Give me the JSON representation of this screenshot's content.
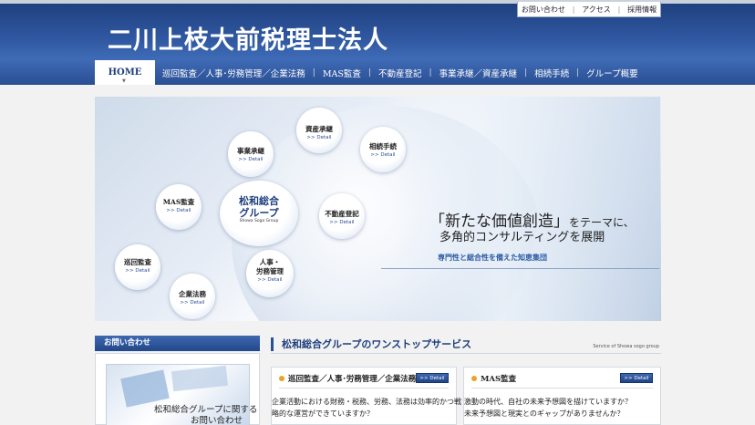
{
  "header": {
    "site_title": "二川上枝大前税理士法人",
    "util_nav": [
      "お問い合わせ",
      "アクセス",
      "採用情報"
    ]
  },
  "main_nav": {
    "home": "HOME",
    "items": [
      "巡回監査／人事･労務管理／企業法務",
      "MAS監査",
      "不動産登記",
      "事業承継／資産承継",
      "相続手続",
      "グループ概要"
    ]
  },
  "hero": {
    "center": {
      "title": "松和総合\nグループ",
      "sub": "Showa Sogo Group"
    },
    "bubbles": [
      {
        "title": "資産承継",
        "detail": ">> Detail"
      },
      {
        "title": "事業承継",
        "detail": ">> Detail"
      },
      {
        "title": "相続手続",
        "detail": ">> Detail"
      },
      {
        "title": "MAS監査",
        "detail": ">> Detail"
      },
      {
        "title": "不動産登記",
        "detail": ">> Detail"
      },
      {
        "title": "巡回監査",
        "detail": ">> Detail"
      },
      {
        "title": "人事・\n労務管理",
        "detail": ">> Detail"
      },
      {
        "title": "企業法務",
        "detail": ">> Detail"
      }
    ],
    "copy_main": "「新たな価値創造」",
    "copy_theme": "をテーマに、",
    "copy_line2": "多角的コンサルティングを展開",
    "copy_line3": "専門性と総合性を備えた知恵集団"
  },
  "sidebar": {
    "heading": "お問い合わせ",
    "banner_line1": "松和総合グループに関する",
    "banner_line2": "お問い合わせ"
  },
  "section": {
    "title": "松和総合グループのワンストップサービス",
    "subtitle": "Service of Showa sogo group"
  },
  "cards": [
    {
      "title": "巡回監査／人事･労務管理／企業法務",
      "detail": ">> Detail",
      "body1": "企業活動における財務・税務、労務、法務は効率的かつ戦",
      "body2": "略的な運営ができていますか？"
    },
    {
      "title": "MAS監査",
      "detail": ">> Detail",
      "body1": "激動の時代、自社の未来予想図を描けていますか？",
      "body2": "未来予想図と現実とのギャップがありませんか？"
    }
  ]
}
